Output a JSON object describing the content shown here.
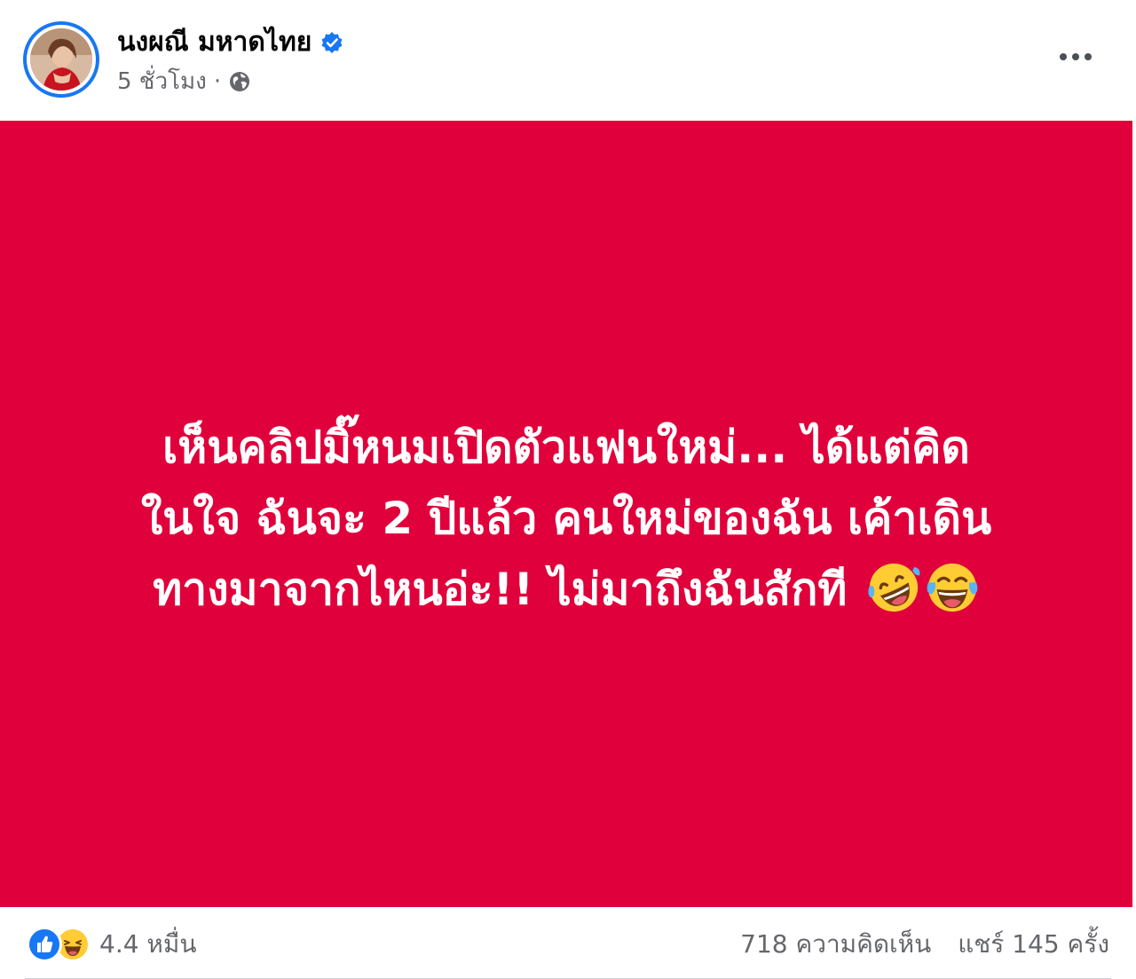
{
  "post": {
    "author_name": "นงผณี มหาดไทย",
    "timestamp": "5 ชั่วโมง",
    "separator": "·",
    "privacy_icon": "globe-icon",
    "verified_icon": "verified-badge-icon",
    "more_icon": "more-options-icon"
  },
  "status": {
    "background_color": "#e0003b",
    "text_color": "#ffffff",
    "line1": "เห็นคลิปมิ๊หนมเปิดตัวแฟนใหม่... ได้แต่คิด",
    "line2": "ในใจ ฉันจะ 2 ปีแล้ว คนใหม่ของฉัน เค้าเดิน",
    "line3": "ทางมาจากไหนอ่ะ!! ไม่มาถึงฉันสักที",
    "emojis": [
      "rolling-on-floor-laughing-icon",
      "tears-of-joy-icon"
    ]
  },
  "footer": {
    "reaction_icons": [
      "like-icon",
      "haha-icon"
    ],
    "reaction_count": "4.4 หมื่น",
    "comments": "718 ความคิดเห็น",
    "shares": "แชร์ 145 ครั้ง"
  },
  "colors": {
    "accent": "#1877f2",
    "secondary_text": "#65676b"
  }
}
